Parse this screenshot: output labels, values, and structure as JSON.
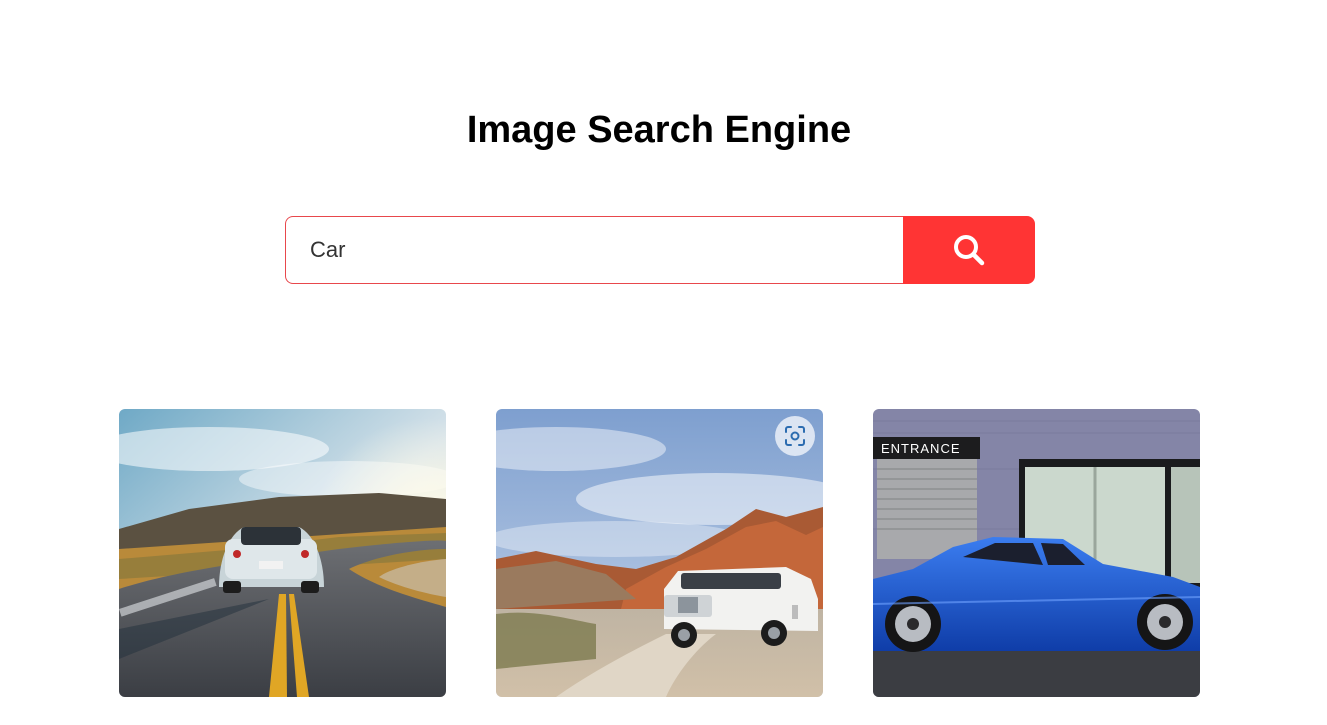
{
  "page": {
    "title": "Image Search Engine"
  },
  "search": {
    "value": "Car",
    "button_icon": "search-icon"
  },
  "colors": {
    "accent": "#ff3434",
    "input_border": "#e8474c",
    "text": "#000000"
  },
  "gallery": {
    "images": [
      {
        "name": "photo-sports-car-on-road"
      },
      {
        "name": "photo-white-suv-in-desert",
        "overlay_icon": "visual-search-lens-icon"
      },
      {
        "name": "photo-blue-coupe-by-entrance",
        "sign_text": "ENTRANCE"
      }
    ]
  }
}
